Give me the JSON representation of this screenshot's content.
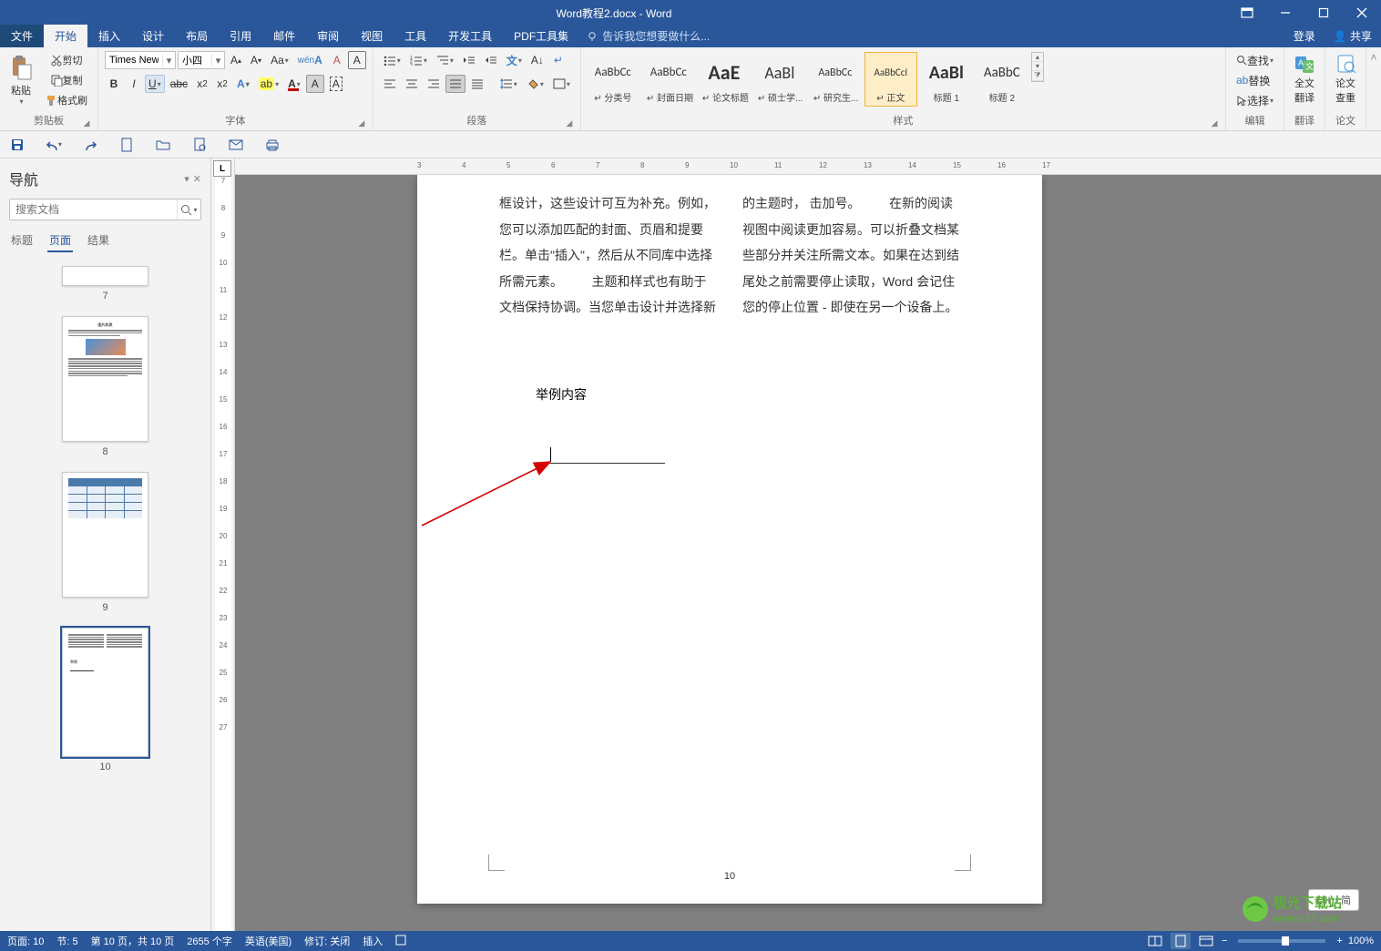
{
  "title": "Word教程2.docx - Word",
  "ribbon_tabs": {
    "file": "文件",
    "home": "开始",
    "insert": "插入",
    "design": "设计",
    "layout": "布局",
    "references": "引用",
    "mailings": "邮件",
    "review": "审阅",
    "view": "视图",
    "tools": "工具",
    "developer": "开发工具",
    "pdf": "PDF工具集",
    "tell_me": "告诉我您想要做什么...",
    "login": "登录",
    "share": "共享"
  },
  "clipboard": {
    "paste": "粘贴",
    "cut": "剪切",
    "copy": "复制",
    "format_painter": "格式刷",
    "label": "剪贴板"
  },
  "font": {
    "name": "Times New R",
    "size": "小四",
    "label": "字体"
  },
  "paragraph": {
    "label": "段落"
  },
  "styles": {
    "label": "样式",
    "items": [
      {
        "preview": "AaBbCc",
        "name": "↵ 分类号",
        "size": "13px",
        "color": "#333",
        "weight": "normal"
      },
      {
        "preview": "AaBbCc",
        "name": "↵ 封面日期",
        "size": "13px",
        "color": "#333",
        "weight": "normal"
      },
      {
        "preview": "AaE",
        "name": "↵ 论文标题",
        "size": "22px",
        "color": "#000",
        "weight": "bold"
      },
      {
        "preview": "AaBl",
        "name": "↵ 硕士学...",
        "size": "18px",
        "color": "#333",
        "weight": "normal"
      },
      {
        "preview": "AaBbCc",
        "name": "↵ 研究生...",
        "size": "12px",
        "color": "#333",
        "weight": "normal"
      },
      {
        "preview": "AaBbCcI",
        "name": "↵ 正文",
        "size": "11px",
        "color": "#333",
        "weight": "normal"
      },
      {
        "preview": "AaBl",
        "name": "标题 1",
        "size": "20px",
        "color": "#000",
        "weight": "bold"
      },
      {
        "preview": "AaBbC",
        "name": "标题 2",
        "size": "15px",
        "color": "#333",
        "weight": "normal"
      }
    ]
  },
  "editing": {
    "find": "查找",
    "replace": "替换",
    "select": "选择",
    "label": "编辑"
  },
  "translate": {
    "full": "全文",
    "translate": "翻译",
    "label": "翻译"
  },
  "thesis": {
    "l1": "论文",
    "l2": "查重",
    "label": "论文"
  },
  "nav": {
    "title": "导航",
    "search_ph": "搜索文档",
    "tab_headings": "标题",
    "tab_pages": "页面",
    "tab_results": "结果",
    "thumb7": "7",
    "thumb8": "8",
    "thumb9": "9",
    "thumb10": "10"
  },
  "doc": {
    "p1": "框设计，这些设计可互为补充。例如，您可以添加匹配的封面、页眉和提要栏。单击\"插入\"，然后从不同库中选择所需元素。",
    "p2": "　　主题和样式也有助于文档保持协调。当您单击设计并选择新的主题时，",
    "p3": "击加号。",
    "p4": "　　在新的阅读视图中阅读更加容易。可以折叠文档某些部分并关注所需文本。如果在达到结尾处之前需要停止读取，Word 会记住您的停止位置 - 即使在另一个设备上。",
    "example": "举例内容",
    "page_num": "10"
  },
  "ime": "CH ♪ 简",
  "status": {
    "page": "页面: 10",
    "section": "节: 5",
    "pages": "第 10 页，共 10 页",
    "words": "2655 个字",
    "lang": "英语(美国)",
    "track": "修订: 关闭",
    "insert": "插入",
    "zoom": "100%"
  },
  "watermark": {
    "t1": "极光下载站",
    "t2": "www.xz7.com"
  }
}
